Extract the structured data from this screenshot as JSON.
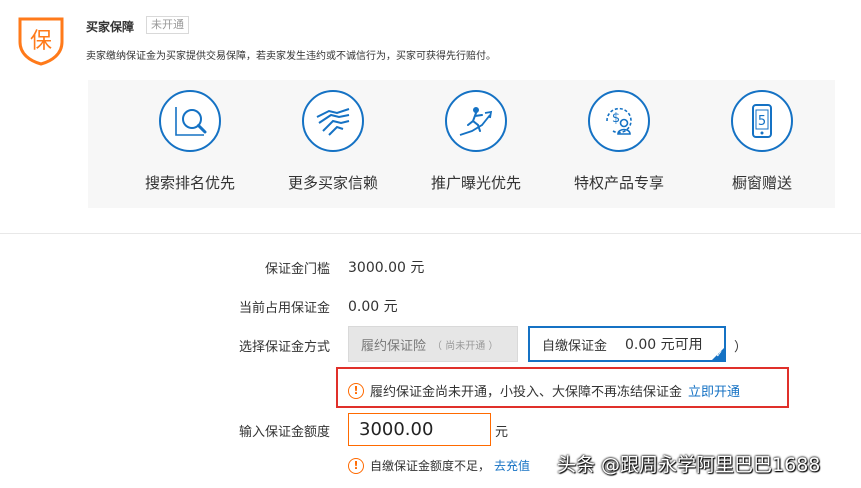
{
  "header": {
    "shield_char": "保",
    "title": "买家保障",
    "badge": "未开通",
    "description": "卖家缴纳保证金为买家提供交易保障，若卖家发生违约或不诚信行为，买家可获得先行赔付。"
  },
  "benefits": [
    {
      "label": "搜索排名优先",
      "icon": "search-chart-icon"
    },
    {
      "label": "更多买家信赖",
      "icon": "handshake-icon"
    },
    {
      "label": "推广曝光优先",
      "icon": "rising-person-icon"
    },
    {
      "label": "特权产品专享",
      "icon": "dollar-person-icon"
    },
    {
      "label": "橱窗赠送",
      "icon": "phone-five-icon",
      "glyph": "5"
    }
  ],
  "threshold": {
    "label": "保证金门槛",
    "value": "3000.00 元"
  },
  "occupied": {
    "label": "当前占用保证金",
    "value": "0.00 元"
  },
  "method": {
    "label": "选择保证金方式",
    "option_insurance": {
      "label": "履约保证险",
      "note": "（ 尚未开通 ）"
    },
    "option_deposit": {
      "label": "自缴保证金",
      "amount": "0.00 元可用"
    },
    "close_paren": "）"
  },
  "notice": {
    "icon": "!",
    "text": "履约保证金尚未开通，小投入、大保障不再冻结保证金",
    "link": "立即开通"
  },
  "amount": {
    "label": "输入保证金额度",
    "value": "3000.00",
    "unit": "元"
  },
  "tip": {
    "icon": "!",
    "text": "自缴保证金额度不足，",
    "link": "去充值"
  },
  "watermark": "头条 @跟周永学阿里巴巴1688",
  "colors": {
    "accent": "#1572c4",
    "warning": "#ff6a00",
    "alert_border": "#e0302a"
  }
}
